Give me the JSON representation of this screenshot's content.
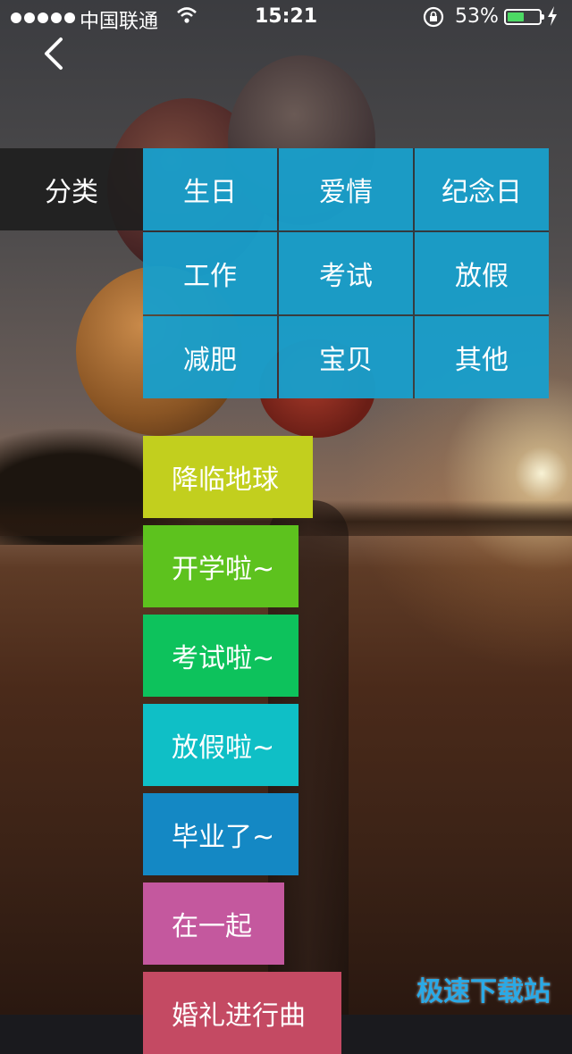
{
  "status_bar": {
    "carrier": "中国联通",
    "time": "15:21",
    "battery_percent": "53%",
    "battery_level": 0.53,
    "battery_color": "#4cd964"
  },
  "nav": {
    "back_icon": "chevron-left-icon"
  },
  "categories": {
    "label": "分类",
    "items": [
      "生日",
      "爱情",
      "纪念日",
      "工作",
      "考试",
      "放假",
      "减肥",
      "宝贝",
      "其他"
    ],
    "accent": "#18a8d8"
  },
  "templates": [
    {
      "label": "降临地球",
      "color": "#c2cf1e"
    },
    {
      "label": "开学啦~",
      "color": "#5dc21e"
    },
    {
      "label": "考试啦~",
      "color": "#0dc25c"
    },
    {
      "label": "放假啦~",
      "color": "#0fbfc6"
    },
    {
      "label": "毕业了~",
      "color": "#1488c4"
    },
    {
      "label": "在一起",
      "color": "#c4589e"
    },
    {
      "label": "婚礼进行曲",
      "color": "#c44a63"
    }
  ],
  "watermark": "极速下载站"
}
